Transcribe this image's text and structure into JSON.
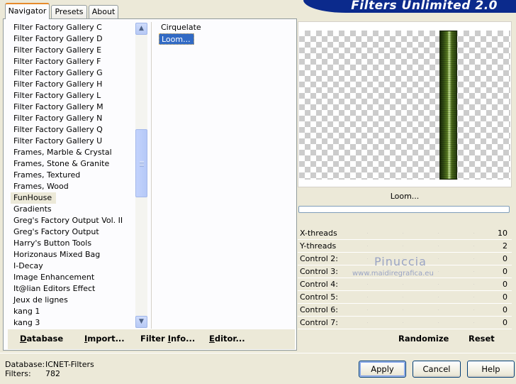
{
  "tabs": [
    {
      "label": "Navigator",
      "active": true
    },
    {
      "label": "Presets",
      "active": false
    },
    {
      "label": "About",
      "active": false
    }
  ],
  "banner": {
    "title": "Filters Unlimited 2.0"
  },
  "categories": [
    "Filter Factory Gallery C",
    "Filter Factory Gallery D",
    "Filter Factory Gallery E",
    "Filter Factory Gallery F",
    "Filter Factory Gallery G",
    "Filter Factory Gallery H",
    "Filter Factory Gallery L",
    "Filter Factory Gallery M",
    "Filter Factory Gallery N",
    "Filter Factory Gallery Q",
    "Filter Factory Gallery U",
    "Frames, Marble & Crystal",
    "Frames, Stone & Granite",
    "Frames, Textured",
    "Frames, Wood",
    "FunHouse",
    "Gradients",
    "Greg's Factory Output Vol. II",
    "Greg's Factory Output",
    "Harry's Button Tools",
    "Horizonaus Mixed Bag",
    "I-Decay",
    "Image Enhancement",
    "It@lian Editors Effect",
    "Jeux de lignes",
    "kang 1",
    "kang 3"
  ],
  "selected_category": "FunHouse",
  "filters": [
    "Cirquelate",
    "Loom..."
  ],
  "selected_filter": "Loom...",
  "panel_buttons": {
    "database": {
      "first": "D",
      "rest": "atabase"
    },
    "import": {
      "first": "I",
      "rest": "mport..."
    },
    "filter_info": {
      "pre": "Filter ",
      "first": "I",
      "rest": "nfo..."
    },
    "editor": {
      "first": "E",
      "rest": "ditor..."
    }
  },
  "preview": {
    "filter_name": "Loom...",
    "progress": 0
  },
  "controls": [
    {
      "label": "X-threads",
      "value": "10"
    },
    {
      "label": "Y-threads",
      "value": "2"
    },
    {
      "label": "Control 2:",
      "value": "0"
    },
    {
      "label": "Control 3:",
      "value": "0"
    },
    {
      "label": "Control 4:",
      "value": "0"
    },
    {
      "label": "Control 5:",
      "value": "0"
    },
    {
      "label": "Control 6:",
      "value": "0"
    },
    {
      "label": "Control 7:",
      "value": "0"
    }
  ],
  "watermark": {
    "line1": "Pinuccia",
    "line2": "www.maidiregrafica.eu"
  },
  "right_buttons": {
    "randomize": "Randomize",
    "reset": "Reset"
  },
  "status": {
    "database_label": "Database:",
    "database_value": "ICNET-Filters",
    "filters_label": "Filters:",
    "filters_value": "782"
  },
  "dialog_buttons": {
    "apply": "Apply",
    "cancel": "Cancel",
    "help": "Help"
  },
  "colors": {
    "selection": "#316ac5",
    "tab_accent": "#e68b2c",
    "banner": "#0b2a8c"
  }
}
